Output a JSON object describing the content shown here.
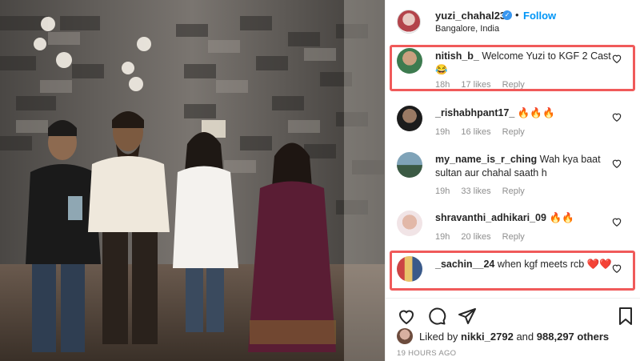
{
  "post": {
    "username": "yuzi_chahal23",
    "follow_label": "Follow",
    "separator": "•",
    "location": "Bangalore, India",
    "liked_prefix": "Liked by",
    "liked_user": "nikki_2792",
    "liked_and": "and",
    "liked_count": "988,297 others",
    "timestamp": "19 HOURS AGO"
  },
  "comments": [
    {
      "user": "nitish_b_",
      "text": "Welcome Yuzi to KGF 2 Cast 😂",
      "age": "18h",
      "likes": "17 likes",
      "reply": "Reply"
    },
    {
      "user": "_rishabhpant17_",
      "text": "🔥🔥🔥",
      "age": "19h",
      "likes": "16 likes",
      "reply": "Reply"
    },
    {
      "user": "my_name_is_r_ching",
      "text": "Wah kya baat sultan aur chahal saath h",
      "age": "19h",
      "likes": "33 likes",
      "reply": "Reply"
    },
    {
      "user": "shravanthi_adhikari_09",
      "text": "🔥🔥",
      "age": "19h",
      "likes": "20 likes",
      "reply": "Reply"
    },
    {
      "user": "_sachin__24",
      "text": "when kgf meets rcb ❤️❤️",
      "age": "",
      "likes": "",
      "reply": ""
    }
  ],
  "colors": {
    "highlight": "#f05a5a",
    "link": "#0095f6",
    "meta": "#8e8e8e"
  },
  "icons": [
    "verified-badge-icon",
    "heart-icon",
    "comment-icon",
    "share-icon",
    "bookmark-icon"
  ]
}
